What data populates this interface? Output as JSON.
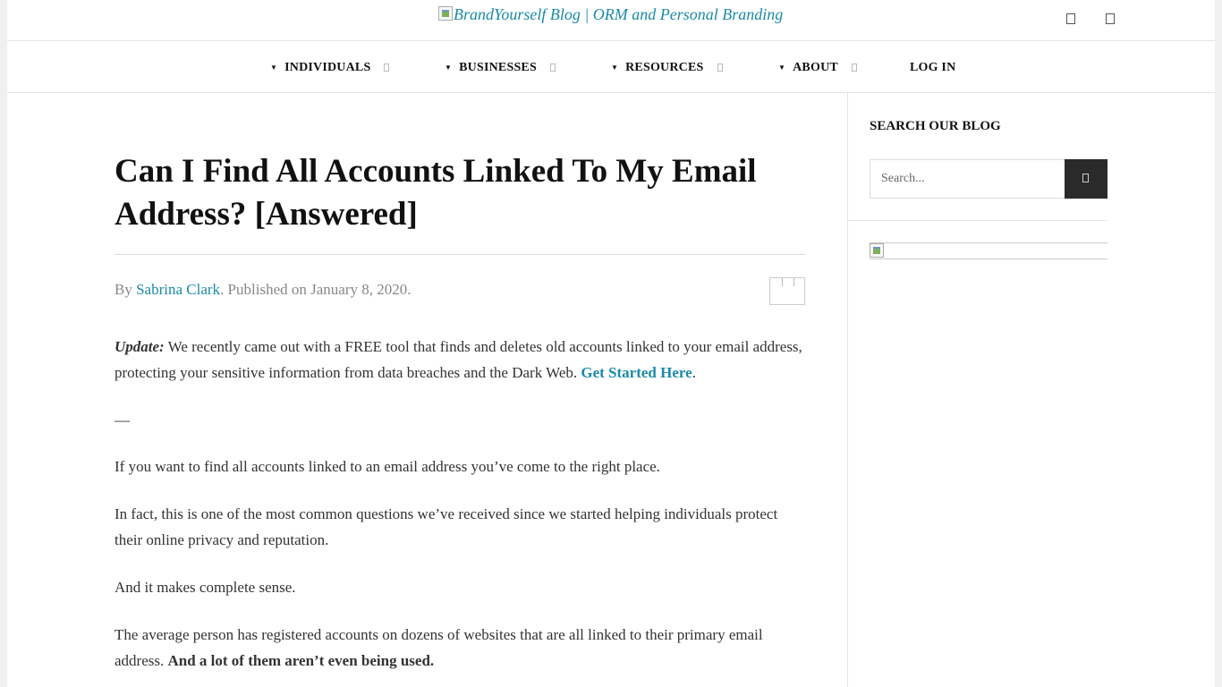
{
  "header": {
    "logo_alt": "BrandYourself Blog | ORM and Personal Branding",
    "icons": [
      "search-icon",
      "menu-icon"
    ]
  },
  "nav": {
    "items": [
      {
        "label": "INDIVIDUALS",
        "has_dropdown": true
      },
      {
        "label": "BUSINESSES",
        "has_dropdown": true
      },
      {
        "label": "RESOURCES",
        "has_dropdown": true
      },
      {
        "label": "ABOUT",
        "has_dropdown": true
      },
      {
        "label": "LOG IN",
        "has_dropdown": false
      }
    ]
  },
  "article": {
    "title": "Can I Find All Accounts Linked To My Email Address? [Answered]",
    "byline_prefix": "By ",
    "author": "Sabrina Clark",
    "byline_suffix": ". Published on January 8, 2020.",
    "update_label": "Update:",
    "update_text": " We recently came out with a FREE tool that finds and deletes old accounts linked to your email address, protecting your sensitive information from data breaches and the Dark Web. ",
    "update_link": "Get Started Here",
    "update_end": ".",
    "separator": "—",
    "paragraphs": [
      "If you want to find all accounts linked to an email address you’ve come to the right place.",
      "In fact, this is one of the most common questions we’ve received since we started helping individuals protect their online privacy and reputation.",
      "And it makes complete sense."
    ],
    "last_paragraph_text": "The average person has registered accounts on dozens of websites that are all linked to their primary email address. ",
    "last_paragraph_bold": "And a lot of them aren’t even being used."
  },
  "sidebar": {
    "search_title": "SEARCH OUR BLOG",
    "search_placeholder": "Search...",
    "search_button_icon": "search-icon"
  },
  "colors": {
    "link": "#1a8aa8",
    "search_button": "#2a2a2a",
    "page_background": "#f0f0f0"
  }
}
